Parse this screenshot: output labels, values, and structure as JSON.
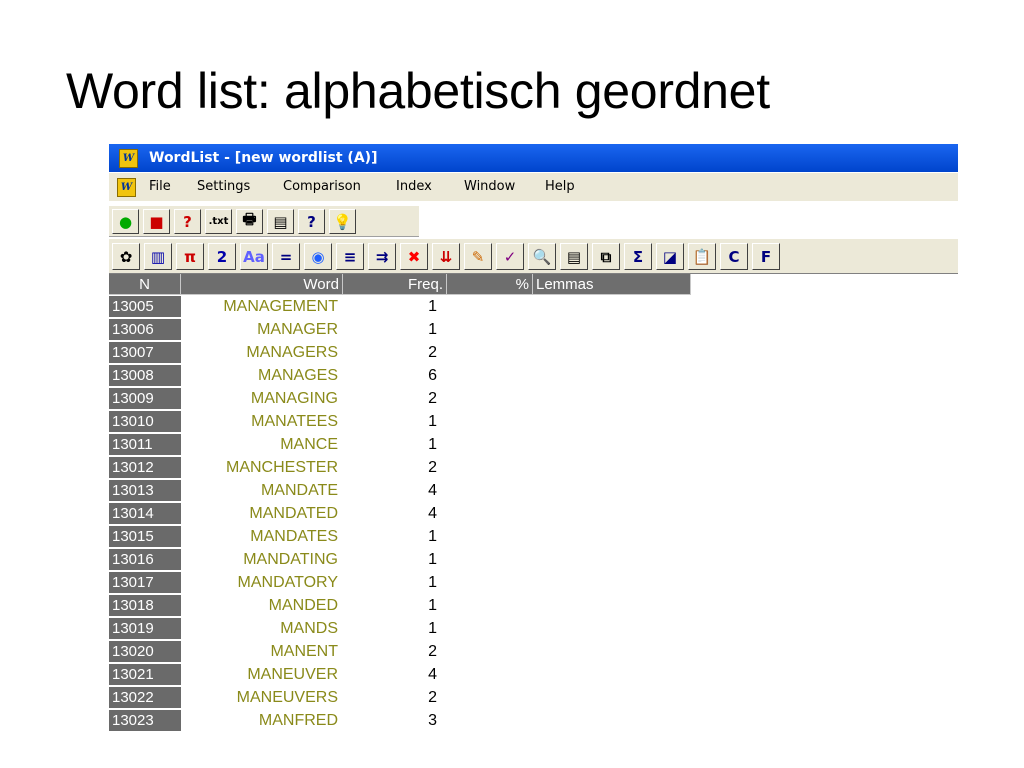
{
  "slide": {
    "title": "Word list: alphabetisch geordnet"
  },
  "window": {
    "title": "WordList - [new wordlist (A)]",
    "logo": "W"
  },
  "menu": {
    "logo": "W",
    "items": [
      "File",
      "Settings",
      "Comparison",
      "Index",
      "Window",
      "Help"
    ]
  },
  "toolbar1": {
    "buttons": [
      {
        "name": "new-circle-icon",
        "glyph": "●",
        "color": "#00aa00"
      },
      {
        "name": "save-disk-icon",
        "glyph": "■",
        "color": "#cc0000"
      },
      {
        "name": "help-book-icon",
        "glyph": "?",
        "color": "#cc0000"
      },
      {
        "name": "txt-icon",
        "glyph": ".txt",
        "color": "#000000"
      },
      {
        "name": "print-icon",
        "glyph": "🖶",
        "color": "#000000"
      },
      {
        "name": "print-preview-icon",
        "glyph": "▤",
        "color": "#000000"
      },
      {
        "name": "question-icon",
        "glyph": "?",
        "color": "#000080"
      },
      {
        "name": "lightbulb-icon",
        "glyph": "💡",
        "color": "#c8a000"
      }
    ]
  },
  "toolbar2": {
    "buttons": [
      {
        "name": "refresh-icon",
        "glyph": "✿",
        "color": "#000000"
      },
      {
        "name": "columns-icon",
        "glyph": "▥",
        "color": "#0000aa"
      },
      {
        "name": "pi-icon",
        "glyph": "π",
        "color": "#cc0000"
      },
      {
        "name": "two-icon",
        "glyph": "2",
        "color": "#0000aa"
      },
      {
        "name": "case-icon",
        "glyph": "Aa",
        "color": "#6060ff"
      },
      {
        "name": "equals-icon",
        "glyph": "=",
        "color": "#000080"
      },
      {
        "name": "compare-icon",
        "glyph": "◉",
        "color": "#2060ff"
      },
      {
        "name": "list-icon",
        "glyph": "≡",
        "color": "#000080"
      },
      {
        "name": "join-icon",
        "glyph": "⇉",
        "color": "#000080"
      },
      {
        "name": "delete-icon",
        "glyph": "✖",
        "color": "#ff0000"
      },
      {
        "name": "sort-down-icon",
        "glyph": "⇊",
        "color": "#cc0000"
      },
      {
        "name": "pencil-icon",
        "glyph": "✎",
        "color": "#cc6600"
      },
      {
        "name": "edit-icon",
        "glyph": "✓",
        "color": "#800080"
      },
      {
        "name": "search-icon",
        "glyph": "🔍",
        "color": "#000000"
      },
      {
        "name": "notes-icon",
        "glyph": "▤",
        "color": "#000000"
      },
      {
        "name": "cluster-icon",
        "glyph": "⧉",
        "color": "#000000"
      },
      {
        "name": "sum-icon",
        "glyph": "Σ",
        "color": "#000080"
      },
      {
        "name": "window-icon",
        "glyph": "◪",
        "color": "#000080"
      },
      {
        "name": "clipboard-icon",
        "glyph": "📋",
        "color": "#000000"
      },
      {
        "name": "c-icon",
        "glyph": "C",
        "color": "#000080"
      },
      {
        "name": "f-icon",
        "glyph": "F",
        "color": "#000080"
      }
    ]
  },
  "grid": {
    "columns": [
      "N",
      "Word",
      "Freq.",
      "%",
      "Lemmas"
    ],
    "rows": [
      {
        "n": "13005",
        "word": "MANAGEMENT",
        "freq": "1"
      },
      {
        "n": "13006",
        "word": "MANAGER",
        "freq": "1"
      },
      {
        "n": "13007",
        "word": "MANAGERS",
        "freq": "2"
      },
      {
        "n": "13008",
        "word": "MANAGES",
        "freq": "6"
      },
      {
        "n": "13009",
        "word": "MANAGING",
        "freq": "2"
      },
      {
        "n": "13010",
        "word": "MANATEES",
        "freq": "1"
      },
      {
        "n": "13011",
        "word": "MANCE",
        "freq": "1"
      },
      {
        "n": "13012",
        "word": "MANCHESTER",
        "freq": "2"
      },
      {
        "n": "13013",
        "word": "MANDATE",
        "freq": "4"
      },
      {
        "n": "13014",
        "word": "MANDATED",
        "freq": "4"
      },
      {
        "n": "13015",
        "word": "MANDATES",
        "freq": "1"
      },
      {
        "n": "13016",
        "word": "MANDATING",
        "freq": "1"
      },
      {
        "n": "13017",
        "word": "MANDATORY",
        "freq": "1"
      },
      {
        "n": "13018",
        "word": "MANDED",
        "freq": "1"
      },
      {
        "n": "13019",
        "word": "MANDS",
        "freq": "1"
      },
      {
        "n": "13020",
        "word": "MANENT",
        "freq": "2"
      },
      {
        "n": "13021",
        "word": "MANEUVER",
        "freq": "4"
      },
      {
        "n": "13022",
        "word": "MANEUVERS",
        "freq": "2"
      },
      {
        "n": "13023",
        "word": "MANFRED",
        "freq": "3"
      }
    ]
  }
}
